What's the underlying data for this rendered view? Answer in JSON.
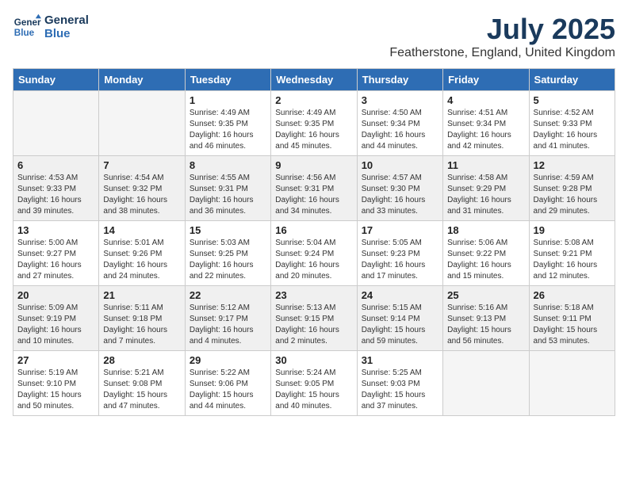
{
  "header": {
    "logo_line1": "General",
    "logo_line2": "Blue",
    "title": "July 2025",
    "location": "Featherstone, England, United Kingdom"
  },
  "days_of_week": [
    "Sunday",
    "Monday",
    "Tuesday",
    "Wednesday",
    "Thursday",
    "Friday",
    "Saturday"
  ],
  "weeks": [
    [
      {
        "day": "",
        "empty": true
      },
      {
        "day": "",
        "empty": true
      },
      {
        "day": "1",
        "rise": "4:49 AM",
        "set": "9:35 PM",
        "daylight": "16 hours and 46 minutes."
      },
      {
        "day": "2",
        "rise": "4:49 AM",
        "set": "9:35 PM",
        "daylight": "16 hours and 45 minutes."
      },
      {
        "day": "3",
        "rise": "4:50 AM",
        "set": "9:34 PM",
        "daylight": "16 hours and 44 minutes."
      },
      {
        "day": "4",
        "rise": "4:51 AM",
        "set": "9:34 PM",
        "daylight": "16 hours and 42 minutes."
      },
      {
        "day": "5",
        "rise": "4:52 AM",
        "set": "9:33 PM",
        "daylight": "16 hours and 41 minutes."
      }
    ],
    [
      {
        "day": "6",
        "rise": "4:53 AM",
        "set": "9:33 PM",
        "daylight": "16 hours and 39 minutes."
      },
      {
        "day": "7",
        "rise": "4:54 AM",
        "set": "9:32 PM",
        "daylight": "16 hours and 38 minutes."
      },
      {
        "day": "8",
        "rise": "4:55 AM",
        "set": "9:31 PM",
        "daylight": "16 hours and 36 minutes."
      },
      {
        "day": "9",
        "rise": "4:56 AM",
        "set": "9:31 PM",
        "daylight": "16 hours and 34 minutes."
      },
      {
        "day": "10",
        "rise": "4:57 AM",
        "set": "9:30 PM",
        "daylight": "16 hours and 33 minutes."
      },
      {
        "day": "11",
        "rise": "4:58 AM",
        "set": "9:29 PM",
        "daylight": "16 hours and 31 minutes."
      },
      {
        "day": "12",
        "rise": "4:59 AM",
        "set": "9:28 PM",
        "daylight": "16 hours and 29 minutes."
      }
    ],
    [
      {
        "day": "13",
        "rise": "5:00 AM",
        "set": "9:27 PM",
        "daylight": "16 hours and 27 minutes."
      },
      {
        "day": "14",
        "rise": "5:01 AM",
        "set": "9:26 PM",
        "daylight": "16 hours and 24 minutes."
      },
      {
        "day": "15",
        "rise": "5:03 AM",
        "set": "9:25 PM",
        "daylight": "16 hours and 22 minutes."
      },
      {
        "day": "16",
        "rise": "5:04 AM",
        "set": "9:24 PM",
        "daylight": "16 hours and 20 minutes."
      },
      {
        "day": "17",
        "rise": "5:05 AM",
        "set": "9:23 PM",
        "daylight": "16 hours and 17 minutes."
      },
      {
        "day": "18",
        "rise": "5:06 AM",
        "set": "9:22 PM",
        "daylight": "16 hours and 15 minutes."
      },
      {
        "day": "19",
        "rise": "5:08 AM",
        "set": "9:21 PM",
        "daylight": "16 hours and 12 minutes."
      }
    ],
    [
      {
        "day": "20",
        "rise": "5:09 AM",
        "set": "9:19 PM",
        "daylight": "16 hours and 10 minutes."
      },
      {
        "day": "21",
        "rise": "5:11 AM",
        "set": "9:18 PM",
        "daylight": "16 hours and 7 minutes."
      },
      {
        "day": "22",
        "rise": "5:12 AM",
        "set": "9:17 PM",
        "daylight": "16 hours and 4 minutes."
      },
      {
        "day": "23",
        "rise": "5:13 AM",
        "set": "9:15 PM",
        "daylight": "16 hours and 2 minutes."
      },
      {
        "day": "24",
        "rise": "5:15 AM",
        "set": "9:14 PM",
        "daylight": "15 hours and 59 minutes."
      },
      {
        "day": "25",
        "rise": "5:16 AM",
        "set": "9:13 PM",
        "daylight": "15 hours and 56 minutes."
      },
      {
        "day": "26",
        "rise": "5:18 AM",
        "set": "9:11 PM",
        "daylight": "15 hours and 53 minutes."
      }
    ],
    [
      {
        "day": "27",
        "rise": "5:19 AM",
        "set": "9:10 PM",
        "daylight": "15 hours and 50 minutes."
      },
      {
        "day": "28",
        "rise": "5:21 AM",
        "set": "9:08 PM",
        "daylight": "15 hours and 47 minutes."
      },
      {
        "day": "29",
        "rise": "5:22 AM",
        "set": "9:06 PM",
        "daylight": "15 hours and 44 minutes."
      },
      {
        "day": "30",
        "rise": "5:24 AM",
        "set": "9:05 PM",
        "daylight": "15 hours and 40 minutes."
      },
      {
        "day": "31",
        "rise": "5:25 AM",
        "set": "9:03 PM",
        "daylight": "15 hours and 37 minutes."
      },
      {
        "day": "",
        "empty": true
      },
      {
        "day": "",
        "empty": true
      }
    ]
  ]
}
